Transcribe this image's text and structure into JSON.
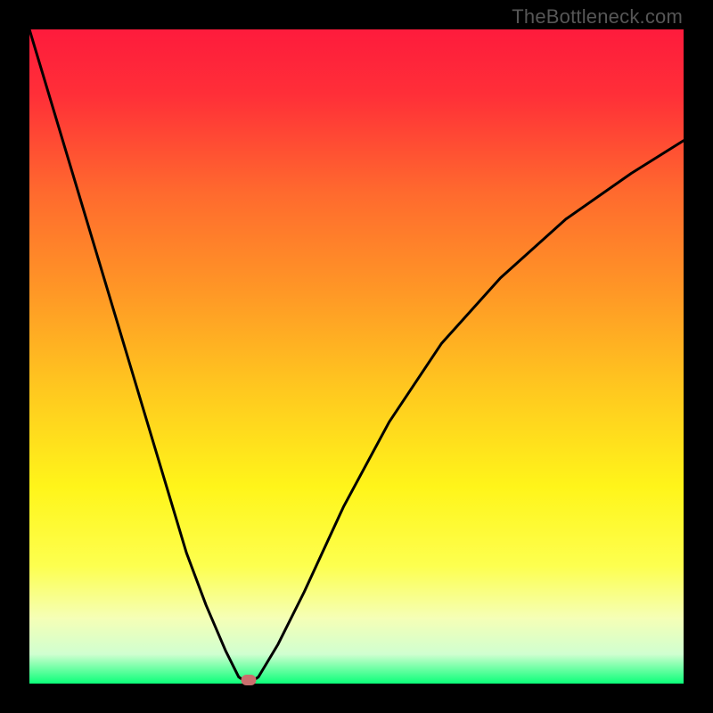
{
  "watermark": "TheBottleneck.com",
  "colors": {
    "brand": "#565656",
    "marker": "#cb6e6d",
    "curve": "#000000",
    "frame": "#000000",
    "gradient_top": "#fe1b3c",
    "gradient_mid1": "#ff8f27",
    "gradient_mid2": "#fff51a",
    "gradient_mid3": "#f7ffb0",
    "gradient_bottom": "#0bff79"
  },
  "chart_data": {
    "type": "line",
    "title": "",
    "xlabel": "",
    "ylabel": "",
    "xlim": [
      0,
      100
    ],
    "ylim": [
      0,
      100
    ],
    "series": [
      {
        "name": "bottleneck-curve",
        "x": [
          0,
          3,
          6,
          9,
          12,
          15,
          18,
          21,
          24,
          27,
          30,
          32,
          33.5,
          35,
          38,
          42,
          48,
          55,
          63,
          72,
          82,
          92,
          100
        ],
        "values": [
          100,
          90,
          80,
          70,
          60,
          50,
          40,
          30,
          20,
          12,
          5,
          1,
          0,
          1,
          6,
          14,
          27,
          40,
          52,
          62,
          71,
          78,
          83
        ]
      }
    ],
    "markers": [
      {
        "name": "optimal-point",
        "x": 33.5,
        "y": 0.6
      }
    ],
    "annotations": [
      {
        "text": "TheBottleneck.com",
        "position": "top-right"
      }
    ]
  }
}
